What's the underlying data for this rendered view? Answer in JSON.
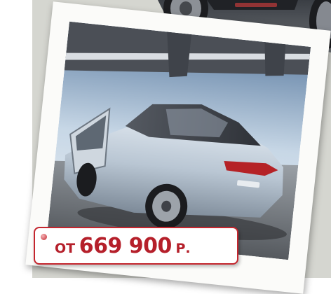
{
  "price_tag": {
    "prefix": "ОТ",
    "amount": "669 900",
    "unit": "Р."
  },
  "colors": {
    "accent": "#c4262e",
    "price_text": "#b51f2a",
    "background": "#d5d6d0",
    "car_body": "#b9c6d3"
  },
  "icons": [
    "bullet-dot-icon"
  ]
}
